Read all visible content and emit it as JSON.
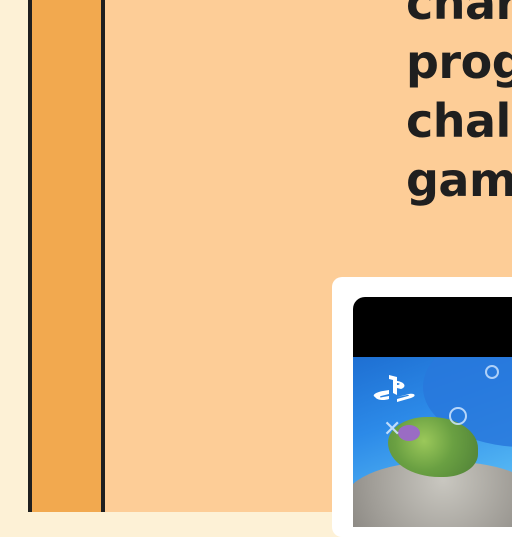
{
  "headline": {
    "lines": [
      "char",
      "prog",
      "chall",
      "gam"
    ]
  },
  "media": {
    "logo_icon": "playstation-logo-icon",
    "overlay_icons": [
      "cross-icon",
      "circle-icon"
    ]
  },
  "colors": {
    "page_background": "#fdf1d6",
    "rail": "#f2a94f",
    "panel": "#fdcd97",
    "text": "#1f1f1f"
  }
}
